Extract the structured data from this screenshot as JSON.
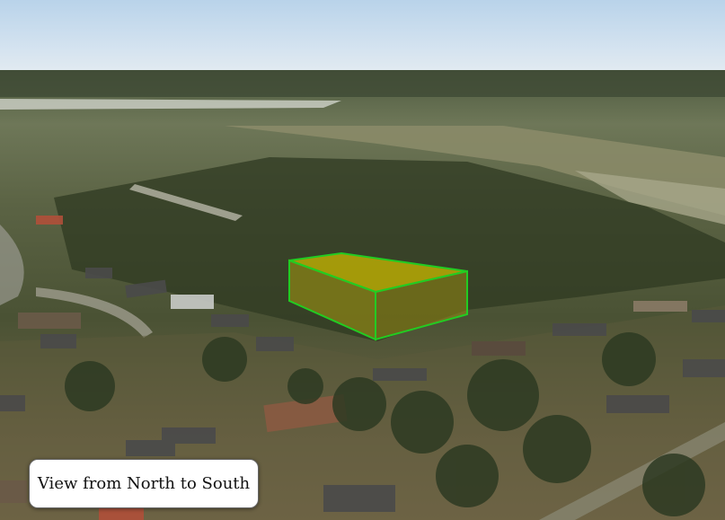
{
  "view": {
    "caption": "View from North to South"
  },
  "colors": {
    "parcel_outline": "#22cc22",
    "parcel_fill": "#c9b800"
  }
}
